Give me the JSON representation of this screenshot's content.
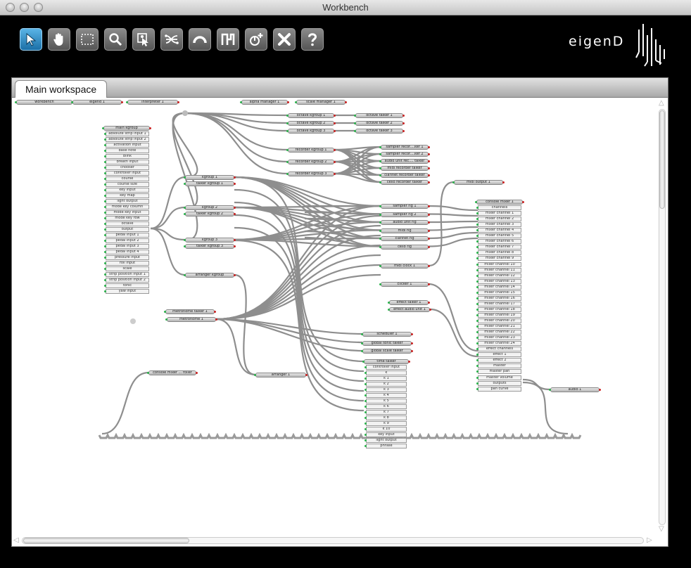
{
  "window": {
    "title": "Workbench"
  },
  "toolbar": {
    "tools": [
      {
        "name": "select-tool",
        "icon": "arrow-pointer-icon"
      },
      {
        "name": "pan-tool",
        "icon": "hand-icon"
      },
      {
        "name": "marquee-tool",
        "icon": "marquee-icon"
      },
      {
        "name": "zoom-tool",
        "icon": "magnifier-icon"
      },
      {
        "name": "inspect-tool",
        "icon": "inspect-cursor-icon"
      },
      {
        "name": "connect-tool",
        "icon": "wires-icon"
      },
      {
        "name": "route-tool",
        "icon": "arc-icon"
      },
      {
        "name": "layout-tool",
        "icon": "step-icon"
      },
      {
        "name": "add-agent-tool",
        "icon": "add-power-icon"
      },
      {
        "name": "delete-tool",
        "icon": "x-icon"
      },
      {
        "name": "help-tool",
        "icon": "question-icon"
      }
    ],
    "brand": "eigenD",
    "accent": "#2a8cd0"
  },
  "workspace": {
    "tab_label": "Main workspace",
    "top_agents": [
      "workbench",
      "eigend 1",
      "interpreter 1",
      "alpha manager 1",
      "scale manager 1"
    ],
    "main_kgroup": {
      "title": "main kgroup",
      "ports": [
        "absolute strip input 1",
        "absolute strip input 2",
        "activation input",
        "base note",
        "blink",
        "breath input",
        "chooser",
        "controller input",
        "course",
        "course size",
        "key input",
        "key map",
        "light output",
        "mode key column",
        "mode key input",
        "mode key row",
        "octave",
        "output",
        "pedal input 1",
        "pedal input 2",
        "pedal input 3",
        "pedal input 4",
        "pressure input",
        "roll input",
        "scale",
        "strip position input 1",
        "strip position input 2",
        "tonic",
        "yaw input"
      ]
    },
    "octave_agents": [
      "octave kgroup 1",
      "octave kgroup 2",
      "octave kgroup 3"
    ],
    "octave_talkers": [
      "octave talker 1",
      "octave talker 2",
      "octave talker 3"
    ],
    "recorder_kgroups": [
      "recorder kgroup 1",
      "recorder kgroup 2",
      "recorder kgroup 3"
    ],
    "recorder_talkers": [
      "sampler recor....ker 1",
      "sampler recor....ker 2",
      "audio unit rec.... talker",
      "midi recorder talker",
      "clarinet recorder talker",
      "cello recorder talker"
    ],
    "kgroups": [
      "kgroup 1",
      "talker kgroup 1",
      "kgroup 2",
      "talker kgroup 2",
      "kgroup 3",
      "talker kgroup 3",
      "arranger kgroup"
    ],
    "rigs": [
      "sampler rig 1",
      "sampler rig 2",
      "audio unit rig",
      "midi rig",
      "clarinet rig",
      "cello rig"
    ],
    "misc": [
      "midi clock 1",
      "clicker 1",
      "effect talker 1",
      "effect audio unit 1",
      "midi output 1",
      "metronome talker 1",
      "metronome 1",
      "arranger 1",
      "console mixer ... roller",
      "scheduler 1",
      "global tonic talker",
      "global scale talker",
      "audio 1"
    ],
    "console_mixer": {
      "title": "console mixer 1",
      "ports": [
        "channels",
        "mixer channel 1",
        "mixer channel 2",
        "mixer channel 3",
        "mixer channel 4",
        "mixer channel 5",
        "mixer channel 6",
        "mixer channel 7",
        "mixer channel 8",
        "mixer channel 9",
        "mixer channel 10",
        "mixer channel 11",
        "mixer channel 12",
        "mixer channel 13",
        "mixer channel 14",
        "mixer channel 15",
        "mixer channel 16",
        "mixer channel 17",
        "mixer channel 18",
        "mixer channel 19",
        "mixer channel 20",
        "mixer channel 21",
        "mixer channel 22",
        "mixer channel 23",
        "mixer channel 24",
        "effect channels",
        "effect 1",
        "effect 2",
        "master",
        "master pan",
        "master volume",
        "outputs",
        "pan curve"
      ]
    },
    "time_talker": {
      "title": "time talker",
      "ports": [
        "controller input",
        "k",
        "k 1",
        "k 2",
        "k 3",
        "k 4",
        "k 5",
        "k 6",
        "k 7",
        "k 8",
        "k 9",
        "k 10",
        "key input",
        "light output",
        "phrase"
      ]
    }
  }
}
